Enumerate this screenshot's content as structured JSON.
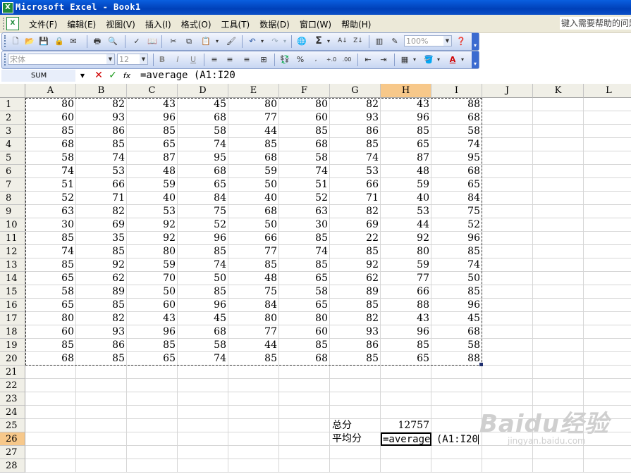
{
  "window": {
    "title": "Microsoft Excel - Book1",
    "app_icon": "excel-icon"
  },
  "menu": {
    "items": [
      "文件(F)",
      "编辑(E)",
      "视图(V)",
      "插入(I)",
      "格式(O)",
      "工具(T)",
      "数据(D)",
      "窗口(W)",
      "帮助(H)"
    ],
    "help_placeholder": "键入需要帮助的问题"
  },
  "toolbar": {
    "zoom": "100%",
    "font_name": "宋体",
    "font_size": "12"
  },
  "formula_bar": {
    "name_box": "SUM",
    "cancel_glyph": "✕",
    "enter_glyph": "✓",
    "fx_glyph": "fx",
    "content": "=average (A1:I20"
  },
  "sheet": {
    "columns": [
      "A",
      "B",
      "C",
      "D",
      "E",
      "F",
      "G",
      "H",
      "I",
      "J",
      "K",
      "L"
    ],
    "active_column": "H",
    "active_row": 26,
    "row_count": 28,
    "data": [
      [
        80,
        82,
        43,
        45,
        80,
        80,
        82,
        43,
        88
      ],
      [
        60,
        93,
        96,
        68,
        77,
        60,
        93,
        96,
        68
      ],
      [
        85,
        86,
        85,
        58,
        44,
        85,
        86,
        85,
        58
      ],
      [
        68,
        85,
        65,
        74,
        85,
        68,
        85,
        65,
        74
      ],
      [
        58,
        74,
        87,
        95,
        68,
        58,
        74,
        87,
        95
      ],
      [
        74,
        53,
        48,
        68,
        59,
        74,
        53,
        48,
        68
      ],
      [
        51,
        66,
        59,
        65,
        50,
        51,
        66,
        59,
        65
      ],
      [
        52,
        71,
        40,
        84,
        40,
        52,
        71,
        40,
        84
      ],
      [
        63,
        82,
        53,
        75,
        68,
        63,
        82,
        53,
        75
      ],
      [
        30,
        69,
        92,
        52,
        50,
        30,
        69,
        44,
        52
      ],
      [
        85,
        35,
        92,
        96,
        66,
        85,
        22,
        92,
        96
      ],
      [
        74,
        85,
        80,
        85,
        77,
        74,
        85,
        80,
        85
      ],
      [
        85,
        92,
        59,
        74,
        85,
        85,
        92,
        59,
        74
      ],
      [
        65,
        62,
        70,
        50,
        48,
        65,
        62,
        77,
        50
      ],
      [
        58,
        89,
        50,
        85,
        75,
        58,
        89,
        66,
        85
      ],
      [
        65,
        85,
        60,
        96,
        84,
        65,
        85,
        88,
        96
      ],
      [
        80,
        82,
        43,
        45,
        80,
        80,
        82,
        43,
        45
      ],
      [
        60,
        93,
        96,
        68,
        77,
        60,
        93,
        96,
        68
      ],
      [
        85,
        86,
        85,
        58,
        44,
        85,
        86,
        85,
        58
      ],
      [
        68,
        85,
        65,
        74,
        85,
        68,
        85,
        65,
        88
      ]
    ],
    "total_label": "总分",
    "total_value": "12757",
    "average_label": "平均分",
    "editing_text": "=average (A1:I20"
  },
  "watermark": {
    "logo": "Baidu经验",
    "url": "jingyan.baidu.com"
  }
}
